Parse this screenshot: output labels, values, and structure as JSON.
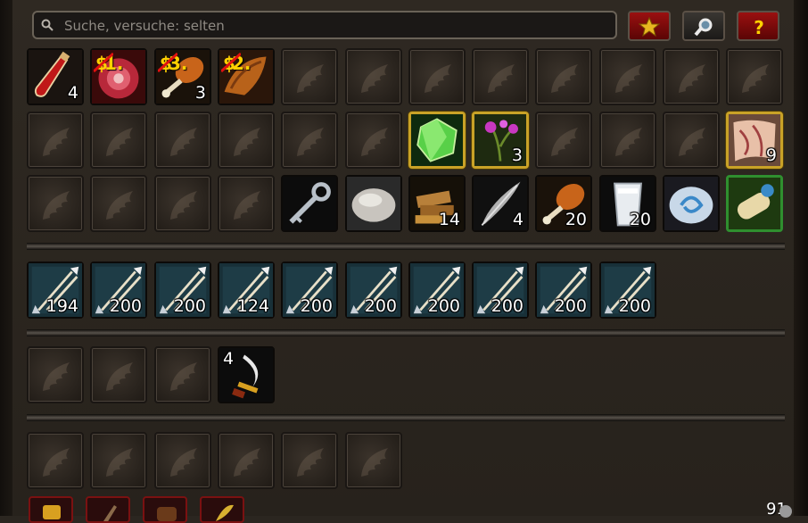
{
  "search": {
    "placeholder": "Suche, versuche: selten"
  },
  "buttons": {
    "star": "star-icon",
    "search": "magnifier-icon",
    "help": "question-icon",
    "help_label": "?"
  },
  "rows": {
    "row1": [
      {
        "item": "potion",
        "count": "4"
      },
      {
        "item": "meat",
        "price": "1."
      },
      {
        "item": "drumstick",
        "count": "3",
        "price": "3."
      },
      {
        "item": "wing-meat",
        "price": "2."
      },
      {},
      {},
      {},
      {},
      {},
      {},
      {},
      {}
    ],
    "row2": [
      {},
      {},
      {},
      {},
      {},
      {},
      {
        "item": "gem",
        "quality": true
      },
      {
        "item": "herb",
        "count": "3",
        "quality": true
      },
      {},
      {},
      {},
      {
        "item": "scroll-map",
        "count": "9",
        "quality": true
      }
    ],
    "row3": [
      {},
      {},
      {},
      {},
      {
        "item": "key"
      },
      {
        "item": "stone"
      },
      {
        "item": "wood",
        "count": "14"
      },
      {
        "item": "feather",
        "count": "4"
      },
      {
        "item": "drumstick",
        "count": "20"
      },
      {
        "item": "milk",
        "count": "20"
      },
      {
        "item": "stone-orb"
      },
      {
        "item": "scroll",
        "green": true
      }
    ],
    "ammo": [
      "194",
      "200",
      "200",
      "124",
      "200",
      "200",
      "200",
      "200",
      "200",
      "200"
    ],
    "row5": [
      {},
      {},
      {},
      {
        "item": "curved-blade",
        "count": "4"
      }
    ],
    "row6": [
      {},
      {},
      {},
      {},
      {},
      {}
    ]
  },
  "money": "91",
  "colors": {
    "quality": "#c9a227",
    "uncommon": "#2f8f2f",
    "price": "#ffd100"
  }
}
